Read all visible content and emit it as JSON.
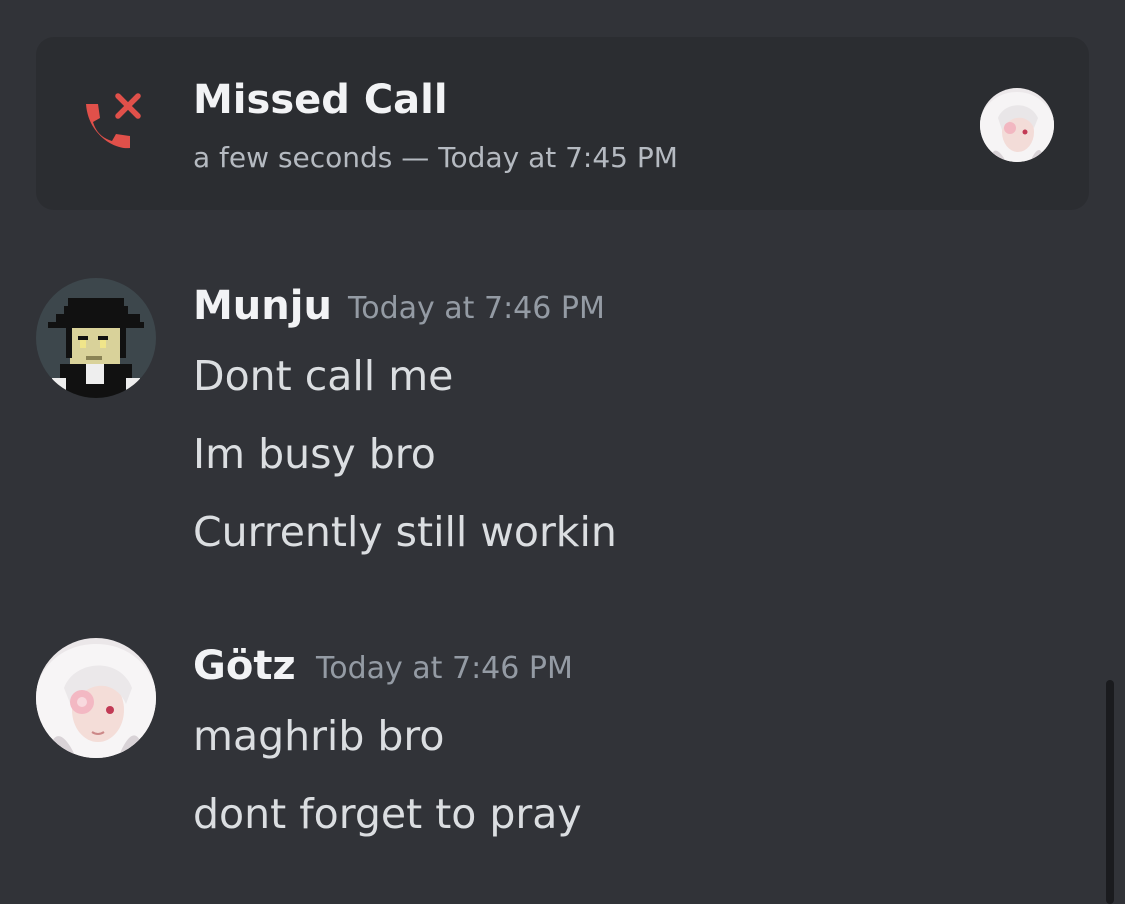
{
  "call": {
    "title": "Missed Call",
    "duration": "a few seconds",
    "separator": " — ",
    "time": "Today at 7:45 PM",
    "icon": "missed-call-icon",
    "icon_color": "#ed4245"
  },
  "messages": [
    {
      "author": "Munju",
      "time": "Today at 7:46 PM",
      "avatar": "pixel-hat-avatar",
      "lines": [
        "Dont call me",
        "Im busy bro",
        "Currently still workin"
      ]
    },
    {
      "author": "Götz",
      "time": "Today at 7:46 PM",
      "avatar": "white-hair-anime-avatar",
      "lines": [
        "maghrib bro",
        "dont forget to pray"
      ]
    }
  ],
  "colors": {
    "background": "#313338",
    "card": "#2b2d31",
    "text": "#dbdee1",
    "muted": "#949ba4"
  }
}
